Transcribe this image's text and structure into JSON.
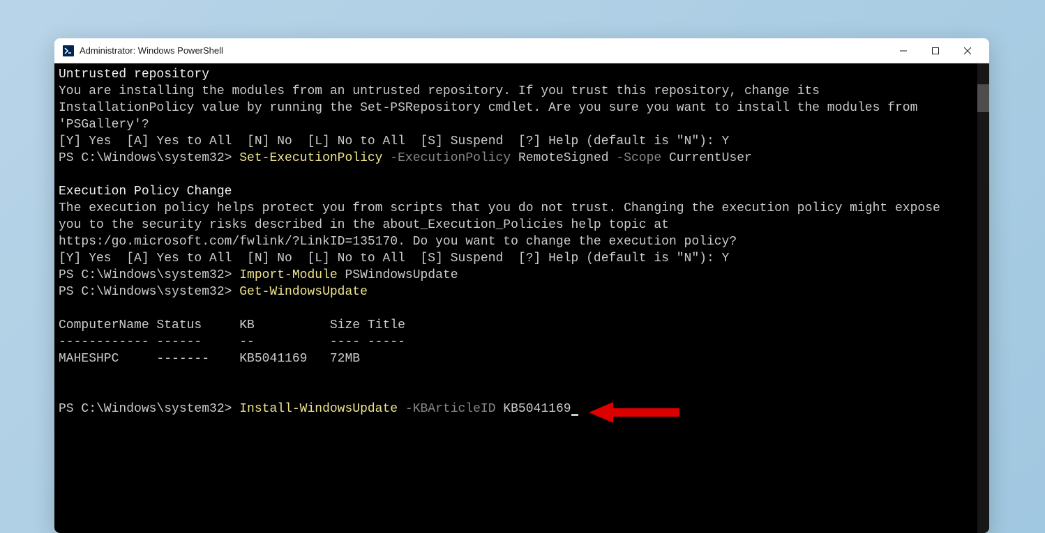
{
  "window": {
    "title": "Administrator: Windows PowerShell"
  },
  "terminal": {
    "line1": "Untrusted repository",
    "line2": "You are installing the modules from an untrusted repository. If you trust this repository, change its",
    "line3": "InstallationPolicy value by running the Set-PSRepository cmdlet. Are you sure you want to install the modules from",
    "line4": "'PSGallery'?",
    "line5": "[Y] Yes  [A] Yes to All  [N] No  [L] No to All  [S] Suspend  [?] Help (default is \"N\"): Y",
    "prompt1": "PS C:\\Windows\\system32> ",
    "cmd1_part1": "Set-ExecutionPolicy ",
    "cmd1_part2": "-ExecutionPolicy ",
    "cmd1_part3": "RemoteSigned ",
    "cmd1_part4": "-Scope ",
    "cmd1_part5": "CurrentUser",
    "line_blank": "",
    "line6": "Execution Policy Change",
    "line7": "The execution policy helps protect you from scripts that you do not trust. Changing the execution policy might expose",
    "line8": "you to the security risks described in the about_Execution_Policies help topic at",
    "line9": "https:/go.microsoft.com/fwlink/?LinkID=135170. Do you want to change the execution policy?",
    "line10": "[Y] Yes  [A] Yes to All  [N] No  [L] No to All  [S] Suspend  [?] Help (default is \"N\"): Y",
    "prompt2": "PS C:\\Windows\\system32> ",
    "cmd2_part1": "Import-Module ",
    "cmd2_part2": "PSWindowsUpdate",
    "prompt3": "PS C:\\Windows\\system32> ",
    "cmd3": "Get-WindowsUpdate",
    "table_header": "ComputerName Status     KB          Size Title",
    "table_divider": "------------ ------     --          ---- -----",
    "table_row1": "MAHESHPC     -------    KB5041169   72MB",
    "prompt4": "PS C:\\Windows\\system32> ",
    "cmd4_part1": "Install-WindowsUpdate ",
    "cmd4_part2": "-KBArticleID ",
    "cmd4_part3": "KB5041169"
  }
}
